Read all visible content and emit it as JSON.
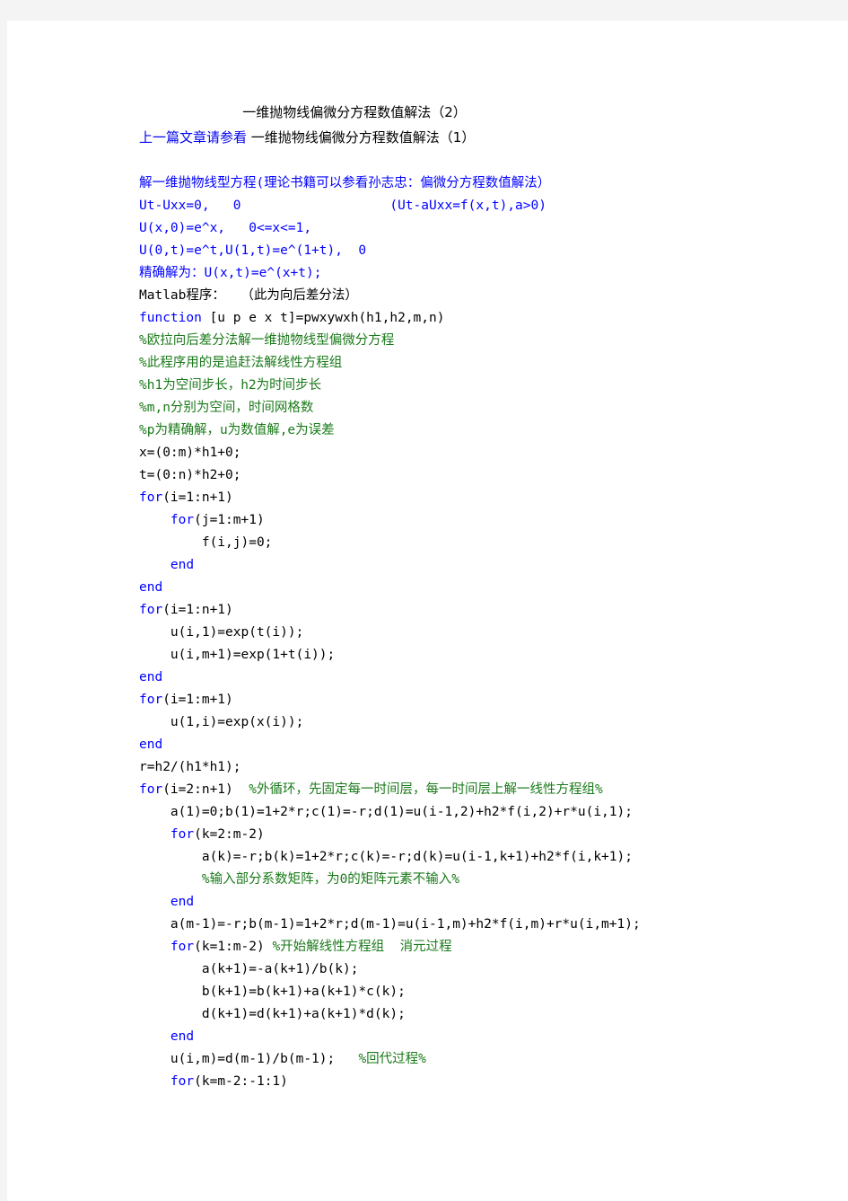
{
  "page": {
    "background_color": "#f4f4f4",
    "sheet_color": "#ffffff"
  },
  "colors": {
    "keyword_blue": "#0000ff",
    "comment_green": "#1a7a1a",
    "plain_black": "#000000",
    "link_blue": "#0000ee"
  },
  "header": {
    "title": "一维抛物线偏微分方程数值解法（2）",
    "prev_link_label": "上一篇文章请参看",
    "prev_article_title": " 一维抛物线偏微分方程数值解法（1）"
  },
  "code": {
    "language": "matlab",
    "lines": [
      {
        "indent": 0,
        "segments": [
          {
            "color": "blue",
            "text": "解一维抛物线型方程(理论书籍可以参看孙志忠：偏微分方程数值解法）"
          }
        ]
      },
      {
        "indent": 0,
        "segments": [
          {
            "color": "blue",
            "text": "Ut-Uxx=0,   0                   (Ut-aUxx=f(x,t),a>0)"
          }
        ]
      },
      {
        "indent": 0,
        "segments": [
          {
            "color": "blue",
            "text": "U(x,0)=e^x,   0<=x<=1,"
          }
        ]
      },
      {
        "indent": 0,
        "segments": [
          {
            "color": "blue",
            "text": "U(0,t)=e^t,U(1,t)=e^(1+t),  0"
          }
        ]
      },
      {
        "indent": 0,
        "segments": [
          {
            "color": "blue",
            "text": "精确解为：U(x,t)=e^(x+t);"
          }
        ]
      },
      {
        "indent": 0,
        "segments": [
          {
            "color": "black",
            "text": "Matlab程序：  （此为向后差分法）"
          }
        ]
      },
      {
        "indent": 0,
        "segments": [
          {
            "color": "blue",
            "text": "function"
          },
          {
            "color": "black",
            "text": " [u p e x t]=pwxywxh(h1,h2,m,n)"
          }
        ]
      },
      {
        "indent": 0,
        "segments": [
          {
            "color": "green",
            "text": "%欧拉向后差分法解一维抛物线型偏微分方程"
          }
        ]
      },
      {
        "indent": 0,
        "segments": [
          {
            "color": "green",
            "text": "%此程序用的是追赶法解线性方程组"
          }
        ]
      },
      {
        "indent": 0,
        "segments": [
          {
            "color": "green",
            "text": "%h1为空间步长，h2为时间步长"
          }
        ]
      },
      {
        "indent": 0,
        "segments": [
          {
            "color": "green",
            "text": "%m,n分别为空间，时间网格数"
          }
        ]
      },
      {
        "indent": 0,
        "segments": [
          {
            "color": "green",
            "text": "%p为精确解，u为数值解,e为误差"
          }
        ]
      },
      {
        "indent": 0,
        "segments": [
          {
            "color": "black",
            "text": "x=(0:m)*h1+0;"
          }
        ]
      },
      {
        "indent": 0,
        "segments": [
          {
            "color": "black",
            "text": "t=(0:n)*h2+0;"
          }
        ]
      },
      {
        "indent": 0,
        "segments": [
          {
            "color": "blue",
            "text": "for"
          },
          {
            "color": "black",
            "text": "(i=1:n+1)"
          }
        ]
      },
      {
        "indent": 1,
        "segments": [
          {
            "color": "blue",
            "text": "for"
          },
          {
            "color": "black",
            "text": "(j=1:m+1)"
          }
        ]
      },
      {
        "indent": 2,
        "segments": [
          {
            "color": "black",
            "text": "f(i,j)=0;"
          }
        ]
      },
      {
        "indent": 1,
        "segments": [
          {
            "color": "blue",
            "text": "end"
          }
        ]
      },
      {
        "indent": 0,
        "segments": [
          {
            "color": "blue",
            "text": "end"
          }
        ]
      },
      {
        "indent": 0,
        "segments": [
          {
            "color": "blue",
            "text": "for"
          },
          {
            "color": "black",
            "text": "(i=1:n+1)"
          }
        ]
      },
      {
        "indent": 1,
        "segments": [
          {
            "color": "black",
            "text": "u(i,1)=exp(t(i));"
          }
        ]
      },
      {
        "indent": 1,
        "segments": [
          {
            "color": "black",
            "text": "u(i,m+1)=exp(1+t(i));"
          }
        ]
      },
      {
        "indent": 0,
        "segments": [
          {
            "color": "blue",
            "text": "end"
          }
        ]
      },
      {
        "indent": 0,
        "segments": [
          {
            "color": "blue",
            "text": "for"
          },
          {
            "color": "black",
            "text": "(i=1:m+1)"
          }
        ]
      },
      {
        "indent": 1,
        "segments": [
          {
            "color": "black",
            "text": "u(1,i)=exp(x(i));"
          }
        ]
      },
      {
        "indent": 0,
        "segments": [
          {
            "color": "blue",
            "text": "end"
          }
        ]
      },
      {
        "indent": 0,
        "segments": [
          {
            "color": "black",
            "text": "r=h2/(h1*h1);"
          }
        ]
      },
      {
        "indent": 0,
        "segments": [
          {
            "color": "blue",
            "text": "for"
          },
          {
            "color": "black",
            "text": "(i=2:n+1)  "
          },
          {
            "color": "green",
            "text": "%外循环，先固定每一时间层，每一时间层上解一线性方程组%"
          }
        ]
      },
      {
        "indent": 1,
        "segments": [
          {
            "color": "black",
            "text": "a(1)=0;b(1)=1+2*r;c(1)=-r;d(1)=u(i-1,2)+h2*f(i,2)+r*u(i,1);"
          }
        ]
      },
      {
        "indent": 1,
        "segments": [
          {
            "color": "blue",
            "text": "for"
          },
          {
            "color": "black",
            "text": "(k=2:m-2)"
          }
        ]
      },
      {
        "indent": 2,
        "segments": [
          {
            "color": "black",
            "text": "a(k)=-r;b(k)=1+2*r;c(k)=-r;d(k)=u(i-1,k+1)+h2*f(i,k+1);"
          }
        ]
      },
      {
        "indent": 2,
        "segments": [
          {
            "color": "green",
            "text": "%输入部分系数矩阵，为0的矩阵元素不输入%"
          }
        ]
      },
      {
        "indent": 1,
        "segments": [
          {
            "color": "blue",
            "text": "end"
          }
        ]
      },
      {
        "indent": 1,
        "segments": [
          {
            "color": "black",
            "text": "a(m-1)=-r;b(m-1)=1+2*r;d(m-1)=u(i-1,m)+h2*f(i,m)+r*u(i,m+1);"
          }
        ]
      },
      {
        "indent": 1,
        "segments": [
          {
            "color": "blue",
            "text": "for"
          },
          {
            "color": "black",
            "text": "(k=1:m-2) "
          },
          {
            "color": "green",
            "text": "%开始解线性方程组  消元过程"
          }
        ]
      },
      {
        "indent": 2,
        "segments": [
          {
            "color": "black",
            "text": "a(k+1)=-a(k+1)/b(k);"
          }
        ]
      },
      {
        "indent": 2,
        "segments": [
          {
            "color": "black",
            "text": "b(k+1)=b(k+1)+a(k+1)*c(k);"
          }
        ]
      },
      {
        "indent": 2,
        "segments": [
          {
            "color": "black",
            "text": "d(k+1)=d(k+1)+a(k+1)*d(k);"
          }
        ]
      },
      {
        "indent": 1,
        "segments": [
          {
            "color": "blue",
            "text": "end"
          }
        ]
      },
      {
        "indent": 1,
        "segments": [
          {
            "color": "black",
            "text": "u(i,m)=d(m-1)/b(m-1);   "
          },
          {
            "color": "green",
            "text": "%回代过程%"
          }
        ]
      },
      {
        "indent": 1,
        "segments": [
          {
            "color": "blue",
            "text": "for"
          },
          {
            "color": "black",
            "text": "(k=m-2:-1:1)"
          }
        ]
      }
    ]
  }
}
